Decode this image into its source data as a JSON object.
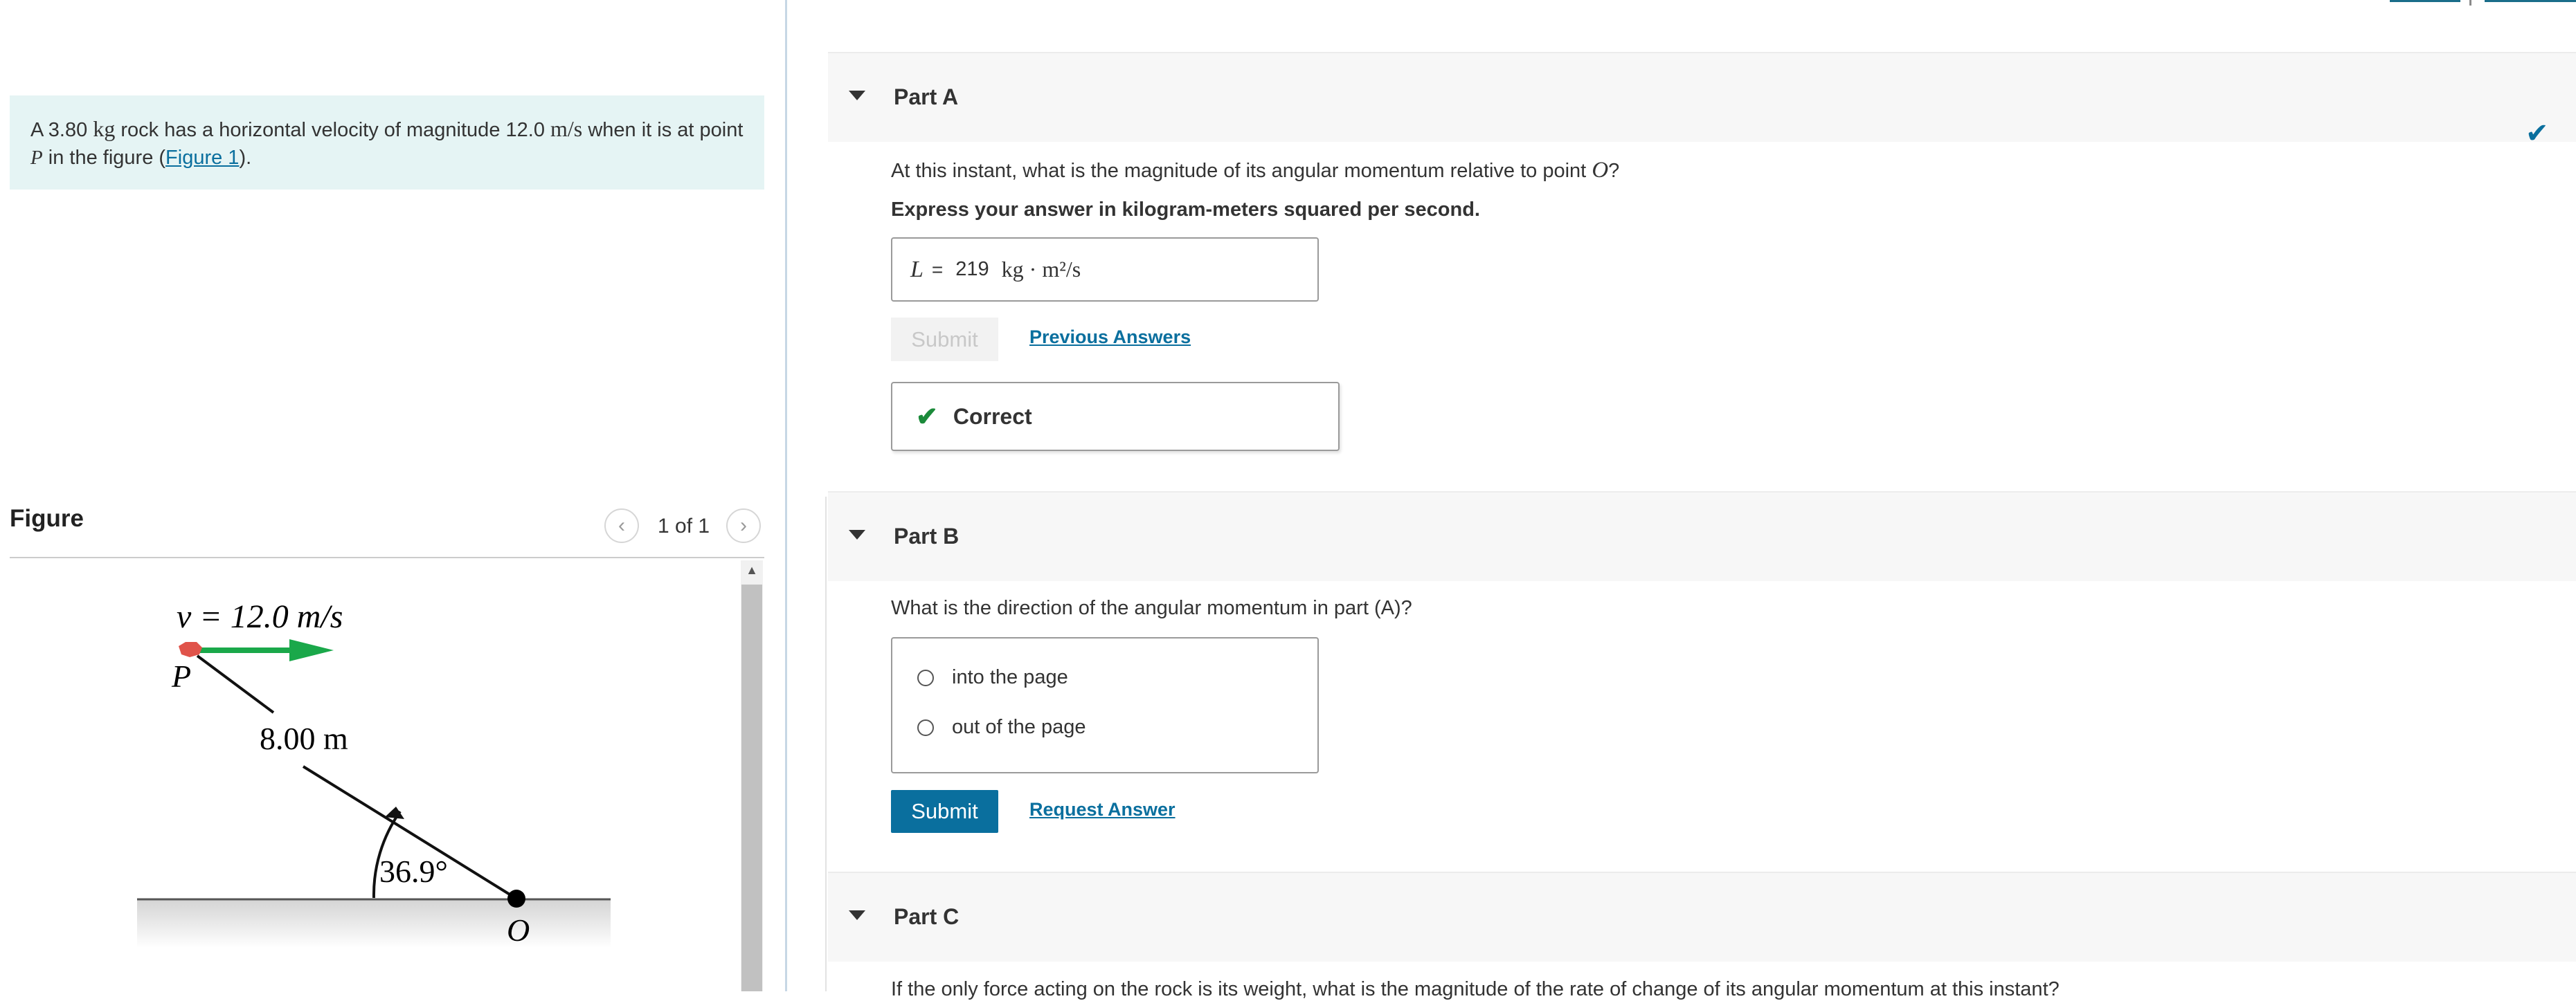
{
  "problem": {
    "text_pre": "A 3.80",
    "mass_unit": "kg",
    "text_mid": "rock has a horizontal velocity of magnitude 12.0",
    "speed_unit": "m/s",
    "text_mid2": "when it is at point",
    "point": "P",
    "text_mid3": "in the figure (",
    "figure_link": "Figure 1",
    "text_end": ")."
  },
  "figure": {
    "title": "Figure",
    "prev_icon": "chevron-left-icon",
    "next_icon": "chevron-right-icon",
    "count": "1 of 1",
    "labels": {
      "velocity": "v = 12.0 m/s",
      "point_p": "P",
      "distance": "8.00 m",
      "angle": "36.9°",
      "origin": "O"
    },
    "colors": {
      "arrow": "#1aa84a",
      "rock": "#e0534a"
    }
  },
  "partA": {
    "title": "Part A",
    "question_pre": "At this instant, what is the magnitude of its angular momentum relative to point",
    "question_point": "O",
    "question_end": "?",
    "instruction": "Express your answer in kilogram-meters squared per second.",
    "answer_var": "L",
    "answer_eq": "=",
    "answer_value": "219",
    "answer_unit": "kg · m²/s",
    "submit_label": "Submit",
    "previous_answers": "Previous Answers",
    "feedback": "Correct"
  },
  "partB": {
    "title": "Part B",
    "question": "What is the direction of the angular momentum in part (A)?",
    "options": [
      "into the page",
      "out of the page"
    ],
    "submit_label": "Submit",
    "request_answer": "Request Answer"
  },
  "partC": {
    "title": "Part C",
    "question": "If the only force acting on the rock is its weight, what is the magnitude of the rate of change of its angular momentum at this instant?"
  },
  "colors": {
    "accent": "#0a6f9e",
    "correct": "#1b8a3a",
    "problem_bg": "#e5f4f4"
  }
}
